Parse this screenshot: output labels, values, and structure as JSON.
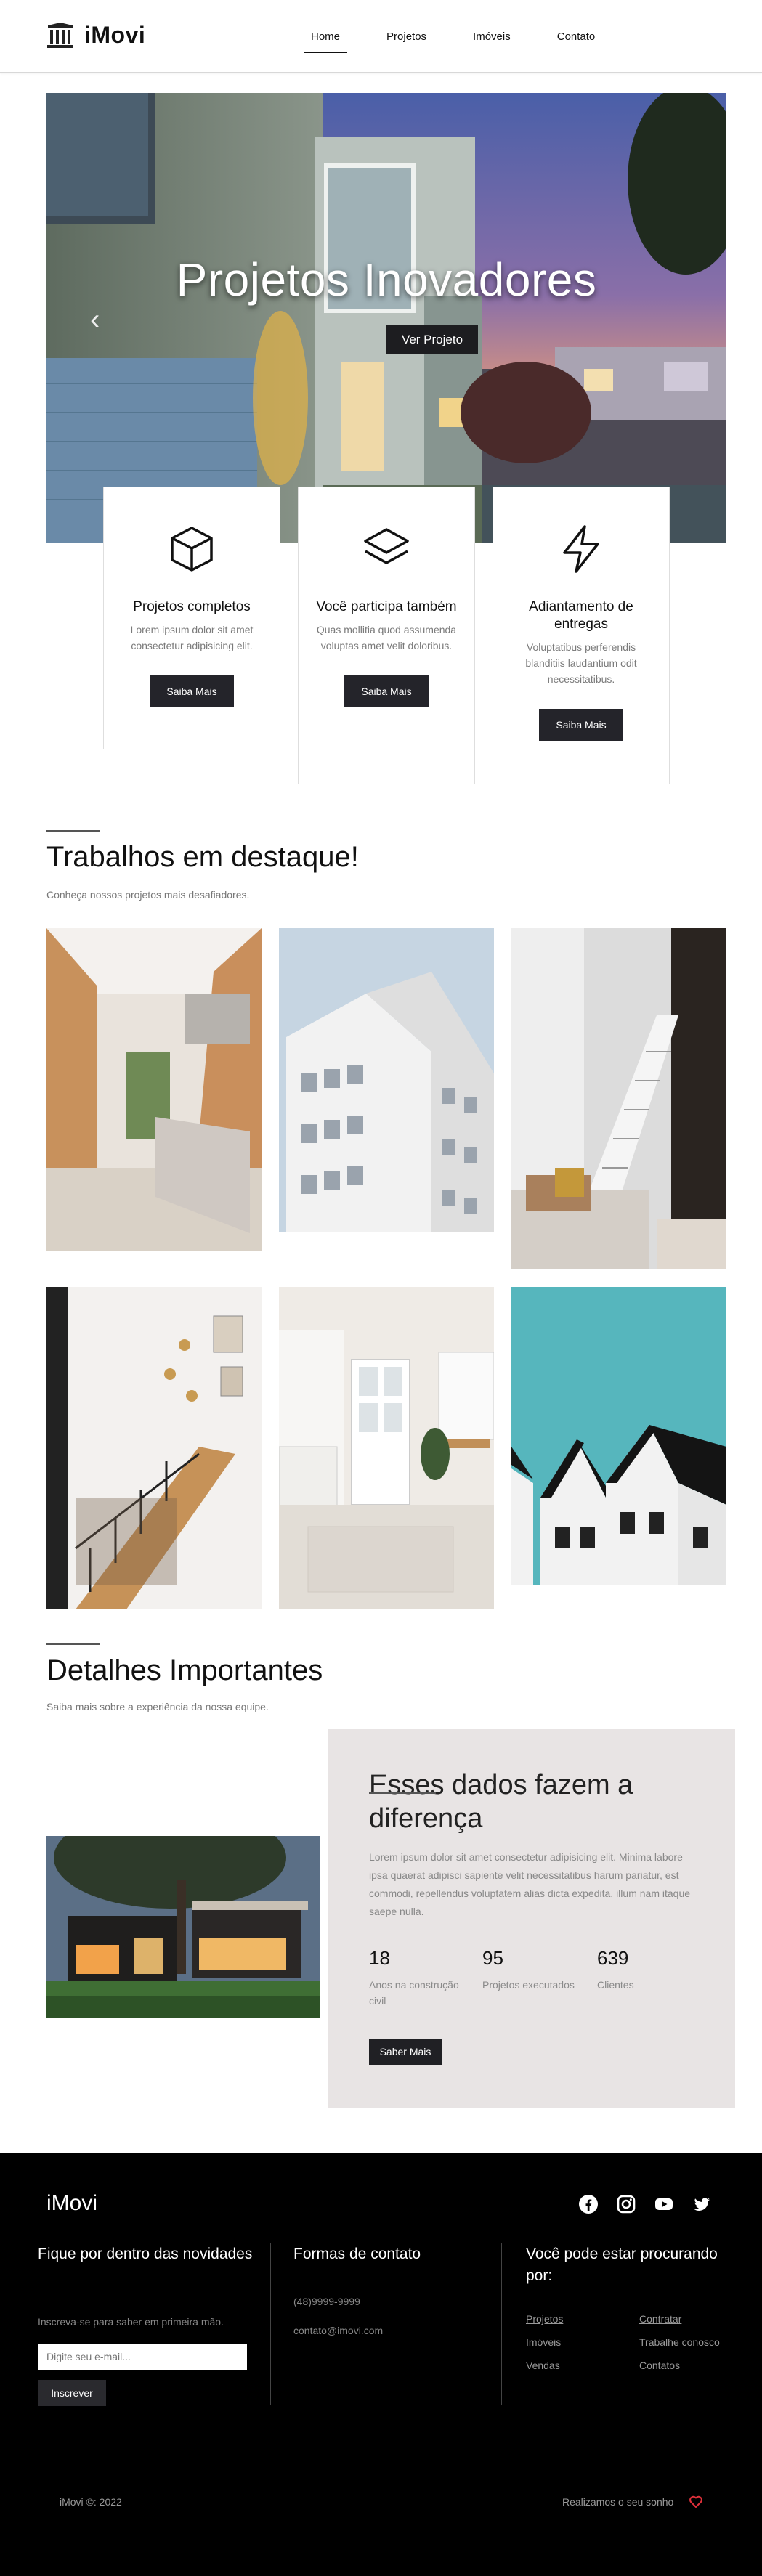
{
  "brand": {
    "name": "iMovi"
  },
  "nav": {
    "items": [
      "Home",
      "Projetos",
      "Imóveis",
      "Contato"
    ]
  },
  "hero": {
    "title": "Projetos Inovadores",
    "button": "Ver Projeto"
  },
  "features": [
    {
      "icon": "cube-icon",
      "title": "Projetos completos",
      "text": "Lorem ipsum dolor sit amet consectetur adipisicing elit.",
      "button": "Saiba Mais"
    },
    {
      "icon": "layers-icon",
      "title": "Você participa também",
      "text": "Quas mollitia quod assumenda voluptas amet velit doloribus.",
      "button": "Saiba Mais"
    },
    {
      "icon": "lightning-icon",
      "title": "Adiantamento de entregas",
      "text": "Voluptatibus perferendis blanditiis laudantium odit necessitatibus.",
      "button": "Saiba Mais"
    }
  ],
  "featured": {
    "title": "Trabalhos em destaque!",
    "subtitle": "Conheça nossos projetos mais desafiadores."
  },
  "details": {
    "title": "Detalhes Importantes",
    "subtitle": "Saiba mais sobre a experiência da nossa equipe.",
    "box_title": "Esses dados fazem a diferença",
    "box_text": "Lorem ipsum dolor sit amet consectetur adipisicing elit. Minima labore ipsa quaerat adipisci sapiente velit necessitatibus harum pariatur, est commodi, repellendus voluptatem alias dicta expedita, illum nam itaque saepe nulla.",
    "stats": [
      {
        "value": "18",
        "label": "Anos na construção civil"
      },
      {
        "value": "95",
        "label": "Projetos executados"
      },
      {
        "value": "639",
        "label": "Clientes"
      }
    ],
    "button": "Saber Mais"
  },
  "footer": {
    "logo": "iMovi",
    "socials": [
      "facebook-icon",
      "instagram-icon",
      "youtube-icon",
      "twitter-icon"
    ],
    "newsletter": {
      "title": "Fique por dentro das novidades",
      "text": "Inscreva-se para saber em primeira mão.",
      "placeholder": "Digite seu e-mail...",
      "button": "Inscrever"
    },
    "contact": {
      "title": "Formas de contato",
      "phone": "(48)9999-9999",
      "email": "contato@imovi.com"
    },
    "links": {
      "title": "Você pode estar procurando por:",
      "items": [
        "Projetos",
        "Contratar",
        "Imóveis",
        "Trabalhe conosco",
        "Vendas",
        "Contatos"
      ]
    },
    "copyright": "iMovi ©: 2022",
    "made": "Realizamos o seu sonho"
  },
  "colors": {
    "accent": "#24242a",
    "footer_bg": "#000000",
    "details_bg": "#e8e4e4",
    "heart": "#e0303a"
  }
}
